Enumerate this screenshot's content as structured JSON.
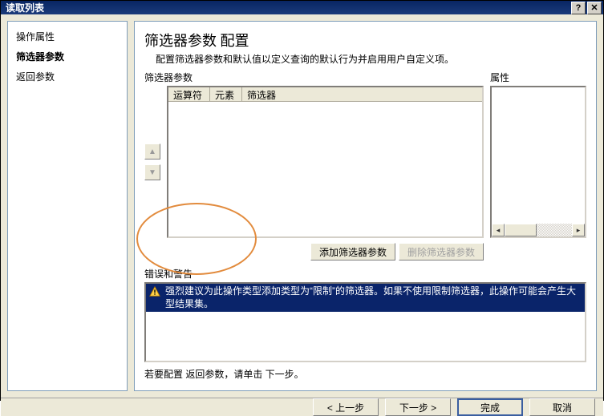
{
  "window": {
    "title": "读取列表"
  },
  "sidebar": {
    "items": [
      {
        "label": "操作属性",
        "bold": false
      },
      {
        "label": "筛选器参数",
        "bold": true
      },
      {
        "label": "返回参数",
        "bold": false
      }
    ]
  },
  "main": {
    "heading": "筛选器参数 配置",
    "description": "配置筛选器参数和默认值以定义查询的默认行为并启用用户自定义项。",
    "filter_label": "筛选器参数",
    "grid_headers": {
      "op": "运算符",
      "elem": "元素",
      "filter": "筛选器"
    },
    "add_btn": "添加筛选器参数",
    "remove_btn": "删除筛选器参数",
    "props_label": "属性",
    "errors_label": "错误和警告",
    "error_text": "强烈建议为此操作类型添加类型为“限制”的筛选器。如果不使用限制筛选器，此操作可能会产生大型结果集。",
    "footer_hint": "若要配置 返回参数，请单击 下一步。"
  },
  "buttons": {
    "back": "< 上一步",
    "next": "下一步 >",
    "finish": "完成",
    "cancel": "取消"
  }
}
